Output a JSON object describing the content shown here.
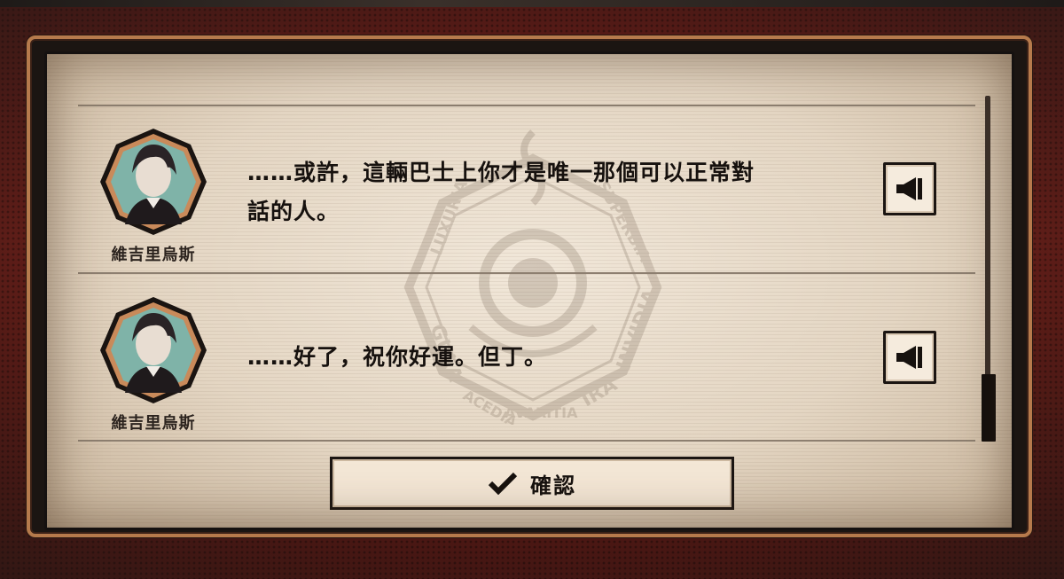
{
  "dialog": {
    "entries": [
      {
        "speaker": "維吉里烏斯",
        "text_line1": "……或許，這輛巴士上你才是唯一那個可以正常對",
        "text_line2": "話的人。",
        "voice_icon": "speaker-icon"
      },
      {
        "speaker": "維吉里烏斯",
        "text_line1": "……好了，祝你好運。但丁。",
        "voice_icon": "speaker-icon"
      }
    ],
    "confirm_label": "確認",
    "confirm_icon": "checkmark-icon"
  },
  "emblem_text": {
    "left": "GULA",
    "right": "INVIDIA",
    "top_left": "LUXURIA",
    "top_right": "SUPERBIA",
    "bottom": "ACEDIA",
    "bottom_mid": "AVARITIA",
    "bottom_right": "IRA"
  },
  "colors": {
    "frame_red": "#5a1a16",
    "copper": "#b67a4c",
    "paper": "#e4d6c3",
    "ink": "#16110e"
  }
}
